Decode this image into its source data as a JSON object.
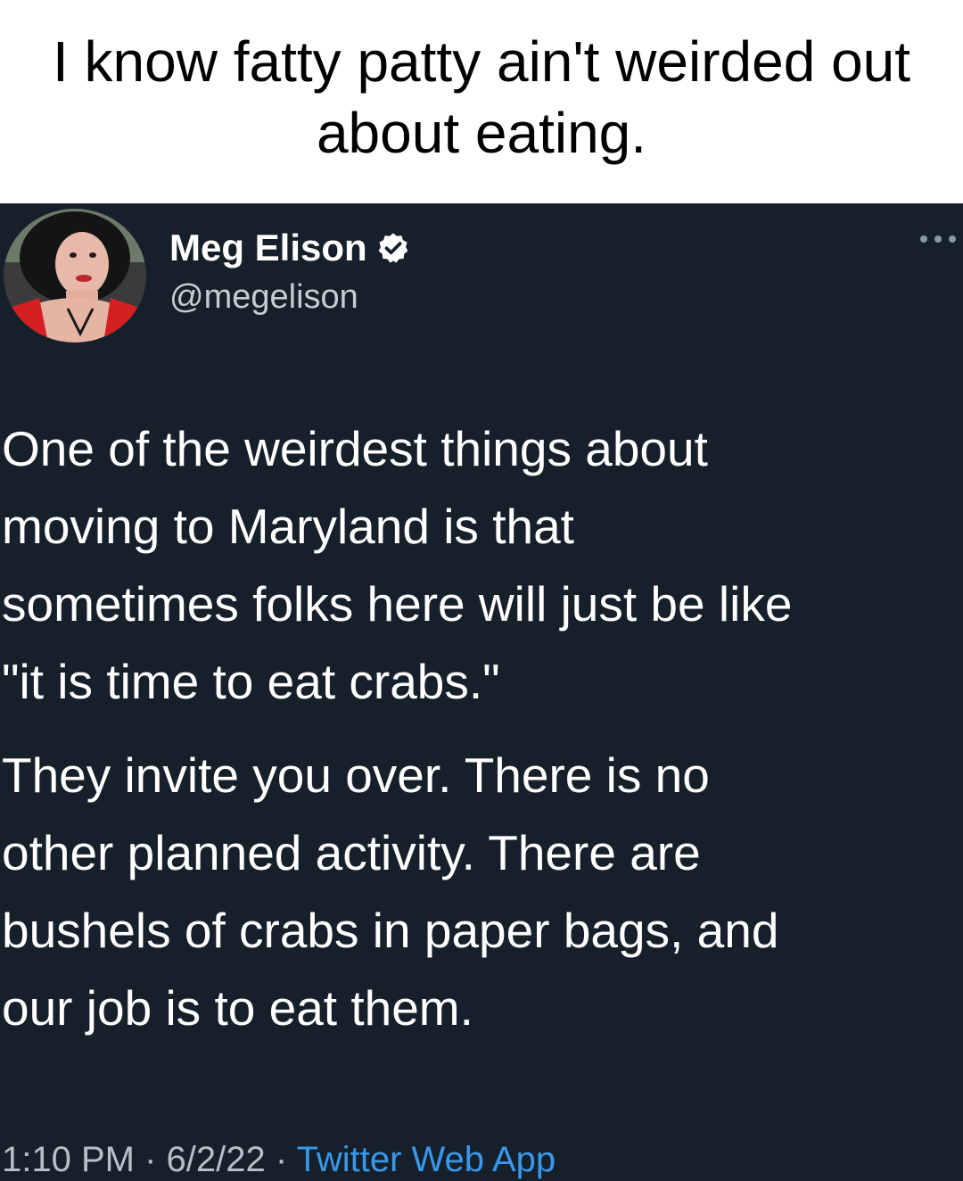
{
  "meme": {
    "caption": "I know fatty patty ain't weirded out about eating."
  },
  "tweet": {
    "author": {
      "name": "Meg Elison",
      "handle": "@megelison",
      "verified": true
    },
    "body": {
      "paragraph_1_lines": [
        "One of the weirdest things about",
        "moving to Maryland is that",
        "sometimes folks here will just be like",
        "\"it is time to eat crabs.\""
      ],
      "paragraph_2_lines": [
        "They invite you over. There is no",
        "other planned activity. There are",
        "bushels of crabs in paper bags, and",
        "our job is to eat them."
      ]
    },
    "meta": {
      "time": "1:10 PM",
      "separator": "·",
      "date": "6/2/22",
      "source": "Twitter Web App"
    }
  },
  "colors": {
    "tweet_background": "#15202b",
    "link": "#3a98ea",
    "secondary_text": "#b8bec5",
    "verified_badge": "#ffffff"
  },
  "icons": {
    "verified": "verified-badge-icon",
    "more": "more-options-icon"
  }
}
